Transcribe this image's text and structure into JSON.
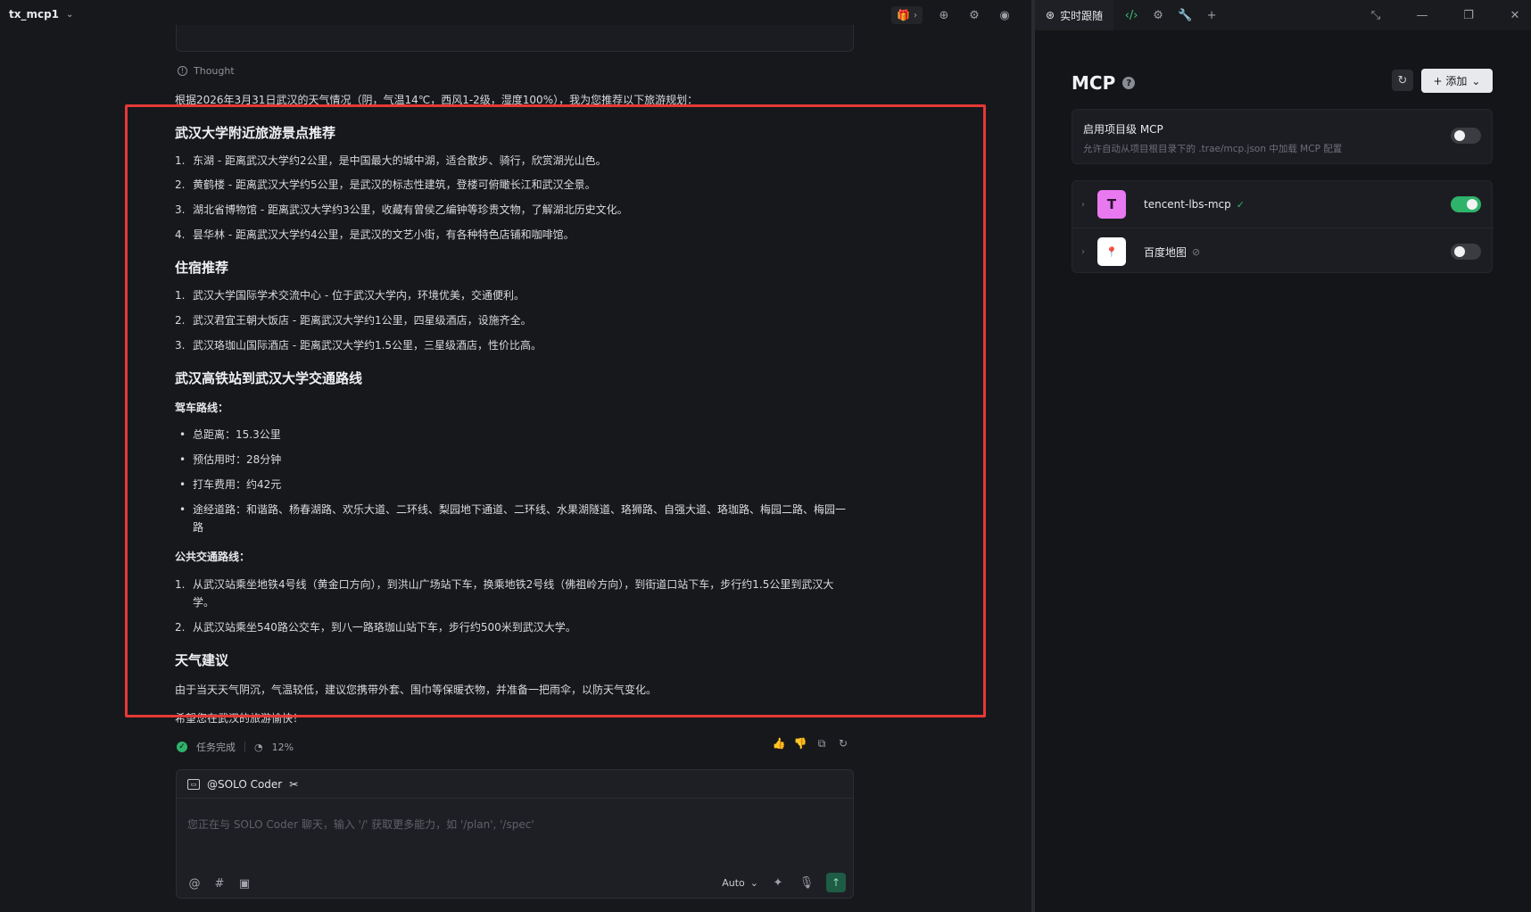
{
  "topbar": {
    "project_name": "tx_mcp1"
  },
  "thought_label": "Thought",
  "message": {
    "intro": "根据2026年3月31日武汉的天气情况（阴，气温14℃，西风1-2级，湿度100%），我为您推荐以下旅游规划：",
    "sec1_title": "武汉大学附近旅游景点推荐",
    "sec1_items": [
      "东湖 - 距离武汉大学约2公里，是中国最大的城中湖，适合散步、骑行，欣赏湖光山色。",
      "黄鹤楼 - 距离武汉大学约5公里，是武汉的标志性建筑，登楼可俯瞰长江和武汉全景。",
      "湖北省博物馆 - 距离武汉大学约3公里，收藏有曾侯乙编钟等珍贵文物，了解湖北历史文化。",
      "昙华林 - 距离武汉大学约4公里，是武汉的文艺小街，有各种特色店铺和咖啡馆。"
    ],
    "sec2_title": "住宿推荐",
    "sec2_items": [
      "武汉大学国际学术交流中心 - 位于武汉大学内，环境优美，交通便利。",
      "武汉君宜王朝大饭店 - 距离武汉大学约1公里，四星级酒店，设施齐全。",
      "武汉珞珈山国际酒店 - 距离武汉大学约1.5公里，三星级酒店，性价比高。"
    ],
    "sec3_title": "武汉高铁站到武汉大学交通路线",
    "drive_label": "驾车路线：",
    "drive_items": [
      "总距离：15.3公里",
      "预估用时：28分钟",
      "打车费用：约42元",
      "途经道路：和谐路、杨春湖路、欢乐大道、二环线、梨园地下通道、二环线、水果湖隧道、珞狮路、自强大道、珞珈路、梅园二路、梅园一路"
    ],
    "transit_label": "公共交通路线：",
    "transit_items": [
      "从武汉站乘坐地铁4号线（黄金口方向），到洪山广场站下车，换乘地铁2号线（佛祖岭方向），到街道口站下车，步行约1.5公里到武汉大学。",
      "从武汉站乘坐540路公交车，到八一路珞珈山站下车，步行约500米到武汉大学。"
    ],
    "sec4_title": "天气建议",
    "weather_text": "由于当天天气阴沉，气温较低，建议您携带外套、围巾等保暖衣物，并准备一把雨伞，以防天气变化。",
    "closing": "希望您在武汉的旅游愉快！"
  },
  "status": {
    "done_label": "任务完成",
    "progress": "12%"
  },
  "composer": {
    "agent": "@SOLO Coder",
    "placeholder": "您正在与 SOLO Coder 聊天，输入 '/' 获取更多能力，如 '/plan', '/spec'",
    "model": "Auto"
  },
  "right": {
    "tab_label": "实时跟随",
    "title": "MCP",
    "add_label": "+ 添加",
    "project_mcp_title": "启用项目级 MCP",
    "project_mcp_desc": "允许自动从项目根目录下的 .trae/mcp.json 中加载 MCP 配置",
    "project_mcp_enabled": false,
    "servers": [
      {
        "name": "tencent-lbs-mcp",
        "avatar": "T",
        "enabled": true,
        "status": "ok"
      },
      {
        "name": "百度地图",
        "avatar": "du",
        "enabled": false,
        "status": "off"
      }
    ]
  },
  "colors": {
    "accent_green": "#2fb36a",
    "highlight_red": "#e53935",
    "tencent_avatar": "#e879f0"
  }
}
